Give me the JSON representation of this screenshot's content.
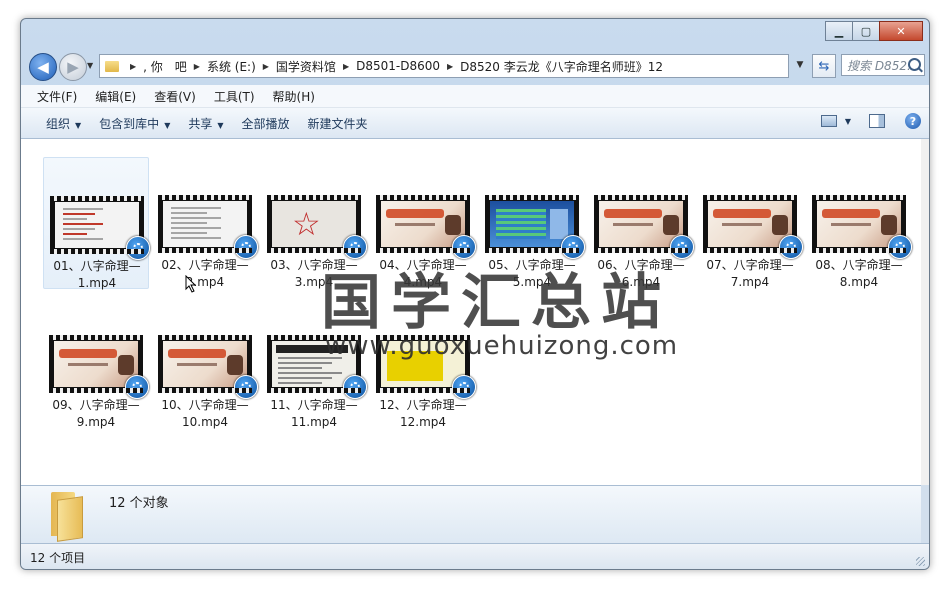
{
  "window": {
    "controls": {
      "minimize": "▁",
      "maximize": "▢",
      "close": "✕"
    }
  },
  "address": {
    "crumbs": [
      ", 你　吧",
      "系统 (E:)",
      "国学资料馆",
      "D8501-D8600",
      "D8520 李云龙《八字命理名师班》12"
    ],
    "search_placeholder": "搜索 D852..."
  },
  "menu": [
    "文件(F)",
    "编辑(E)",
    "查看(V)",
    "工具(T)",
    "帮助(H)"
  ],
  "commands": {
    "organize": "组织",
    "include_library": "包含到库中",
    "share": "共享",
    "play_all": "全部播放",
    "new_folder": "新建文件夹"
  },
  "files": [
    {
      "name": "01、八字命理—1.mp4",
      "thumb": "doc-list"
    },
    {
      "name": "02、八字命理—2.mp4",
      "thumb": "doc-slide"
    },
    {
      "name": "03、八字命理—3.mp4",
      "thumb": "pentagram"
    },
    {
      "name": "04、八字命理—4.mp4",
      "thumb": "title-red"
    },
    {
      "name": "05、八字命理—5.mp4",
      "thumb": "chart-blue"
    },
    {
      "name": "06、八字命理—6.mp4",
      "thumb": "title-red"
    },
    {
      "name": "07、八字命理—7.mp4",
      "thumb": "title-red"
    },
    {
      "name": "08、八字命理—8.mp4",
      "thumb": "title-red"
    },
    {
      "name": "09、八字命理—9.mp4",
      "thumb": "title-red"
    },
    {
      "name": "10、八字命理—10.mp4",
      "thumb": "title-red"
    },
    {
      "name": "11、八字命理—11.mp4",
      "thumb": "news"
    },
    {
      "name": "12、八字命理—12.mp4",
      "thumb": "yellow"
    }
  ],
  "selected_index": 0,
  "watermark": {
    "text": "国学汇总站",
    "url": "www.guoxuehuizong.com"
  },
  "details": {
    "count": "12 个对象"
  },
  "status": {
    "text": "12 个项目"
  }
}
